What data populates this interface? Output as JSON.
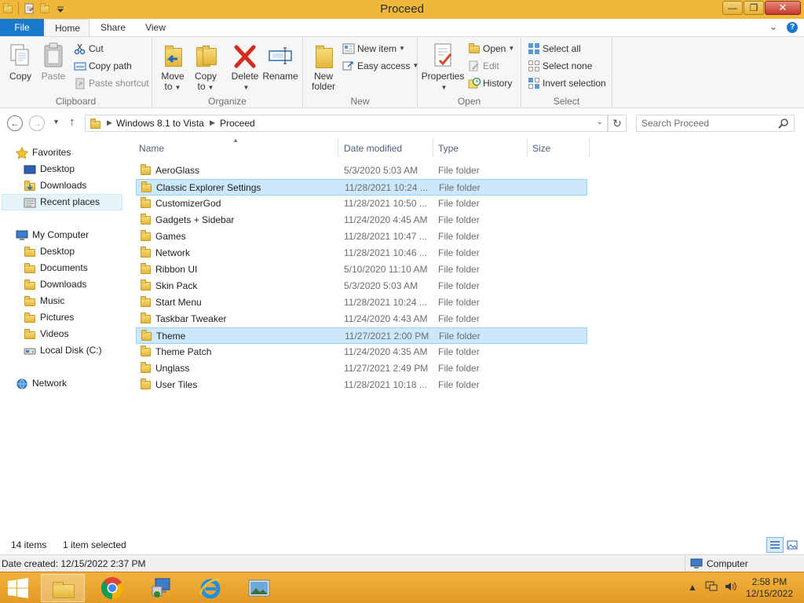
{
  "window": {
    "title": "Proceed"
  },
  "ribbon_tabs": {
    "file": "File",
    "home": "Home",
    "share": "Share",
    "view": "View"
  },
  "ribbon": {
    "clipboard": {
      "group": "Clipboard",
      "copy": "Copy",
      "paste": "Paste",
      "cut": "Cut",
      "copy_path": "Copy path",
      "paste_shortcut": "Paste shortcut"
    },
    "organize": {
      "group": "Organize",
      "move_to": "Move",
      "move_to_2": "to",
      "copy_to": "Copy",
      "copy_to_2": "to",
      "delete": "Delete",
      "rename": "Rename"
    },
    "new": {
      "group": "New",
      "new_folder": "New",
      "new_folder_2": "folder",
      "new_item": "New item",
      "easy_access": "Easy access"
    },
    "open": {
      "group": "Open",
      "properties": "Properties",
      "open": "Open",
      "edit": "Edit",
      "history": "History"
    },
    "select": {
      "group": "Select",
      "select_all": "Select all",
      "select_none": "Select none",
      "invert_selection": "Invert selection"
    }
  },
  "address": {
    "crumbs": [
      "Windows 8.1 to Vista",
      "Proceed"
    ],
    "search_placeholder": "Search Proceed"
  },
  "nav": {
    "favorites": "Favorites",
    "fav_items": [
      "Desktop",
      "Downloads",
      "Recent places"
    ],
    "computer": "My Computer",
    "computer_items": [
      "Desktop",
      "Documents",
      "Downloads",
      "Music",
      "Pictures",
      "Videos",
      "Local Disk (C:)"
    ],
    "network": "Network"
  },
  "columns": {
    "name": "Name",
    "date": "Date modified",
    "type": "Type",
    "size": "Size"
  },
  "files": [
    {
      "name": "AeroGlass",
      "date": "5/3/2020 5:03 AM",
      "type": "File folder"
    },
    {
      "name": "Classic Explorer Settings",
      "date": "11/28/2021 10:24 ...",
      "type": "File folder"
    },
    {
      "name": "CustomizerGod",
      "date": "11/28/2021 10:50 ...",
      "type": "File folder"
    },
    {
      "name": "Gadgets + Sidebar",
      "date": "11/24/2020 4:45 AM",
      "type": "File folder"
    },
    {
      "name": "Games",
      "date": "11/28/2021 10:47 ...",
      "type": "File folder"
    },
    {
      "name": "Network",
      "date": "11/28/2021 10:46 ...",
      "type": "File folder"
    },
    {
      "name": "Ribbon UI",
      "date": "5/10/2020 11:10 AM",
      "type": "File folder"
    },
    {
      "name": "Skin Pack",
      "date": "5/3/2020 5:03 AM",
      "type": "File folder"
    },
    {
      "name": "Start Menu",
      "date": "11/28/2021 10:24 ...",
      "type": "File folder"
    },
    {
      "name": "Taskbar Tweaker",
      "date": "11/24/2020 4:43 AM",
      "type": "File folder"
    },
    {
      "name": "Theme",
      "date": "11/27/2021 2:00 PM",
      "type": "File folder"
    },
    {
      "name": "Theme Patch",
      "date": "11/24/2020 4:35 AM",
      "type": "File folder"
    },
    {
      "name": "Unglass",
      "date": "11/27/2021 2:49 PM",
      "type": "File folder"
    },
    {
      "name": "User Tiles",
      "date": "11/28/2021 10:18 ...",
      "type": "File folder"
    }
  ],
  "status": {
    "count": "14 items",
    "selected": "1 item selected"
  },
  "details": {
    "date_created": "Date created: 12/15/2022 2:37 PM",
    "zone": "Computer"
  },
  "taskbar": {
    "time": "2:58 PM",
    "date": "12/15/2022"
  },
  "colors": {
    "title_bar": "#efb83a",
    "taskbar": "#e49a24",
    "file_tab": "#1979ca",
    "selection": "#cce8ff"
  }
}
